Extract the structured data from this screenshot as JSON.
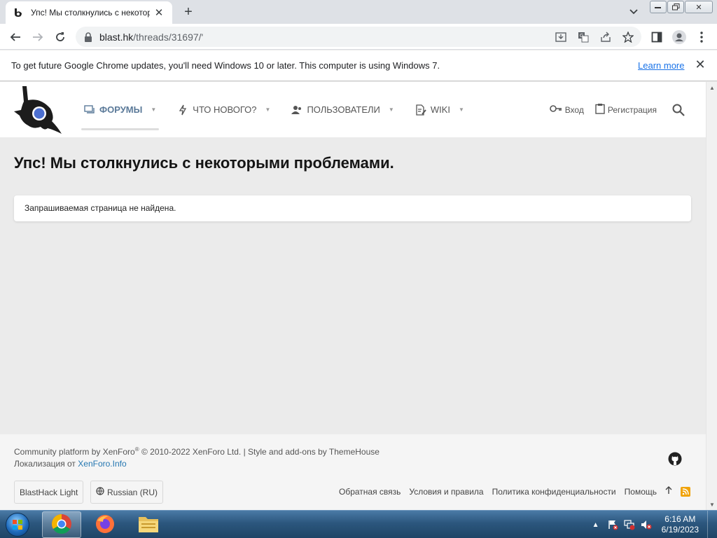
{
  "browser": {
    "tab_title": "Упс! Мы столкнулись с некотор",
    "url_host": "blast.hk",
    "url_path": "/threads/31697/'",
    "window_controls": [
      "minimize",
      "maximize",
      "close"
    ],
    "icons": {
      "back": "back-arrow-icon",
      "forward": "forward-arrow-icon",
      "reload": "reload-icon",
      "lock": "lock-icon",
      "install": "install-icon",
      "translate": "translate-icon",
      "share": "share-icon",
      "bookmark": "star-icon",
      "sidepanel": "side-panel-icon",
      "profile": "profile-icon",
      "menu": "kebab-menu-icon"
    }
  },
  "infobar": {
    "text": "To get future Google Chrome updates, you'll need Windows 10 or later. This computer is using Windows 7.",
    "link": "Learn more"
  },
  "site": {
    "nav": [
      {
        "label": "ФОРУМЫ",
        "icon": "forum-icon",
        "active": true
      },
      {
        "label": "ЧТО НОВОГО?",
        "icon": "bolt-icon",
        "active": false
      },
      {
        "label": "ПОЛЬЗОВАТЕЛИ",
        "icon": "users-icon",
        "active": false
      },
      {
        "label": "WIKI",
        "icon": "wiki-icon",
        "active": false
      }
    ],
    "login": "Вход",
    "register": "Регистрация"
  },
  "main": {
    "title": "Упс! Мы столкнулись с некоторыми проблемами.",
    "message": "Запрашиваемая страница не найдена."
  },
  "footer": {
    "copyright": "Community platform by XenForo",
    "copyright_mark": "®",
    "copyright_rest": " © 2010-2022 XenForo Ltd. | Style and add-ons by ThemeHouse",
    "localization_prefix": "Локализация от ",
    "localization_link": "XenForo.Info",
    "style_button": "BlastHack Light",
    "language_button": "Russian (RU)",
    "links": [
      "Обратная связь",
      "Условия и правила",
      "Политика конфиденциальности",
      "Помощь"
    ]
  },
  "taskbar": {
    "apps": [
      "chrome",
      "firefox",
      "file-explorer"
    ],
    "time": "6:16 AM",
    "date": "6/19/2023"
  },
  "colors": {
    "accent": "#1a73e8",
    "nav_active": "#5b7a99",
    "page_bg": "#ebebeb",
    "rss": "#f0a30a"
  }
}
